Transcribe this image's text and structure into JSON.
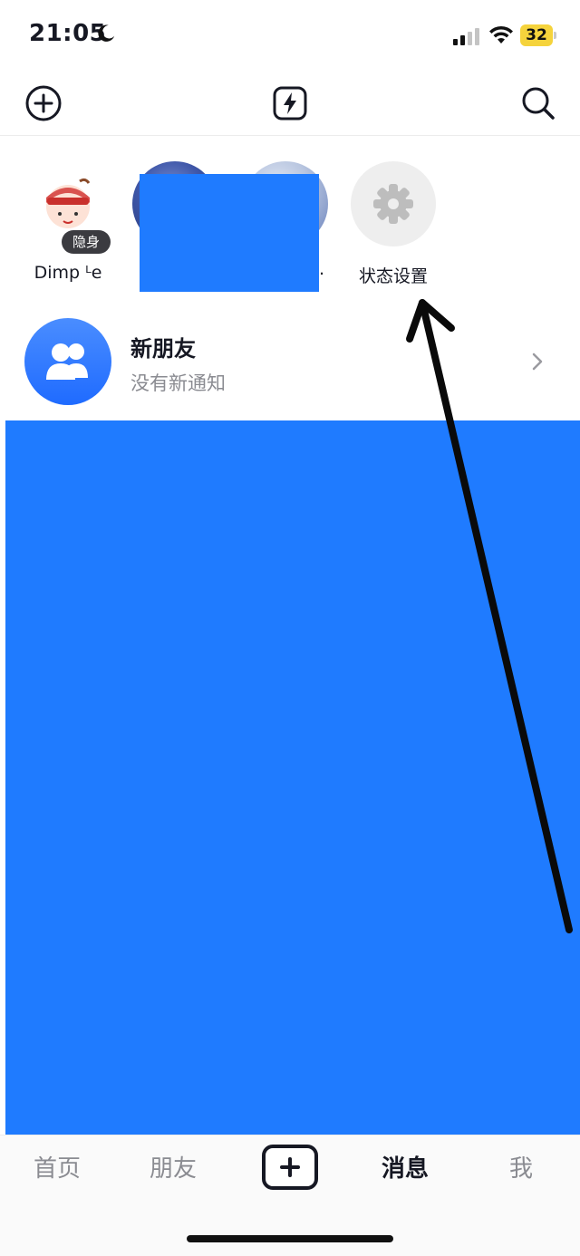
{
  "status_bar": {
    "time": "21:05",
    "battery": "32",
    "icons": [
      "moon-icon",
      "signal-icon",
      "wifi-icon",
      "battery-icon"
    ]
  },
  "toolbar": {
    "icons": [
      "add-circle-icon",
      "flash-icon",
      "search-icon"
    ]
  },
  "status_row": {
    "items": [
      {
        "name": "Dimp ᴸe",
        "badge": "隐身",
        "avatar": "cartoon-avatar"
      },
      {
        "name": "",
        "avatar": "photo-avatar"
      },
      {
        "name": "",
        "avatar": "photo-avatar"
      },
      {
        "name": "状态设置",
        "avatar": "gear-icon"
      }
    ],
    "truncation": ".."
  },
  "new_friends": {
    "title": "新朋友",
    "subtitle": "没有新通知",
    "icon": "people-icon"
  },
  "tabbar": {
    "home": "首页",
    "friends": "朋友",
    "messages": "消息",
    "me": "我",
    "create_icon": "plus-icon"
  },
  "colors": {
    "accent": "#1f7bff",
    "text": "#161823",
    "muted": "#8a8b91",
    "battery": "#f5d33c"
  }
}
